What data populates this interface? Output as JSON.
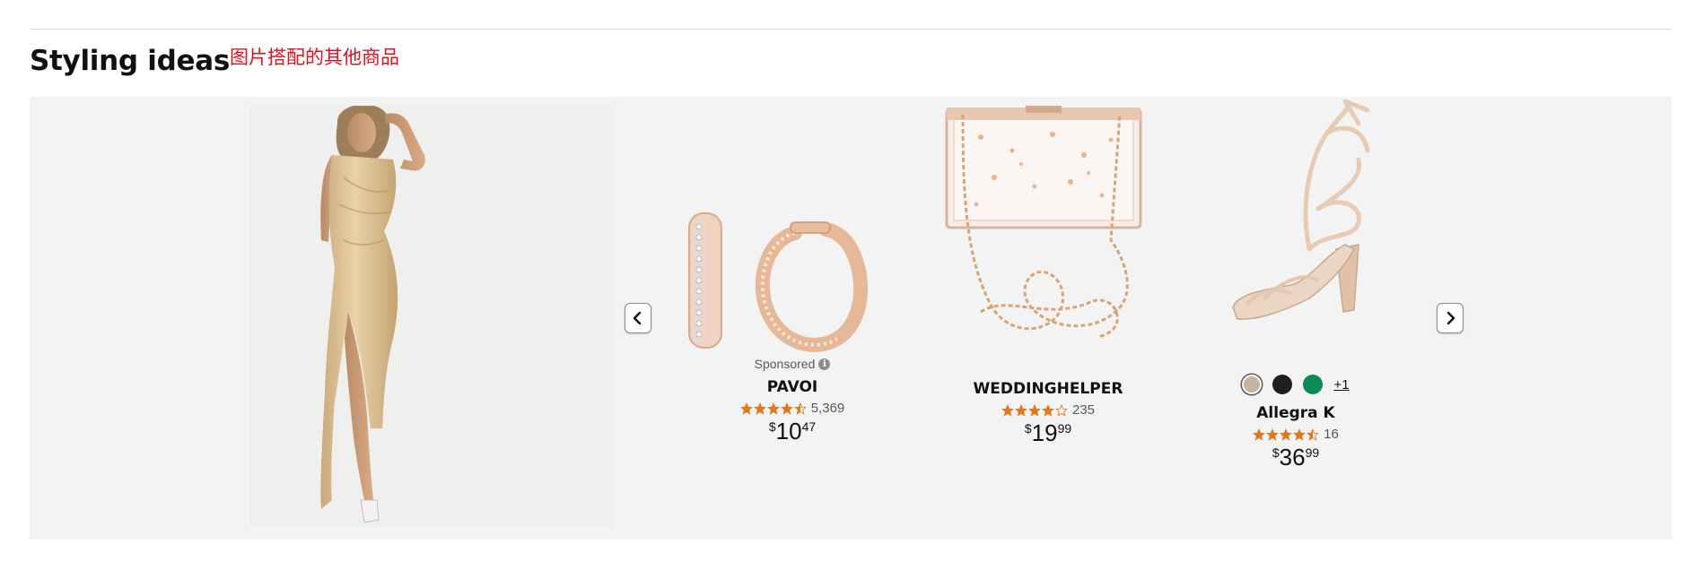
{
  "section": {
    "title": "Styling ideas",
    "annotation": "图片搭配的其他商品"
  },
  "hero": {
    "icon": "dress-photo"
  },
  "carousel": {
    "prev_icon": "chevron-left-icon",
    "next_icon": "chevron-right-icon",
    "products": [
      {
        "sponsored": "Sponsored",
        "brand": "PAVOI",
        "rating": 4.5,
        "rating_count": "5,369",
        "price_currency": "$",
        "price_whole": "10",
        "price_fraction": "47",
        "image_icon": "hoop-earrings-photo"
      },
      {
        "brand": "WEDDINGHELPER",
        "rating": 4.0,
        "rating_count": "235",
        "price_currency": "$",
        "price_whole": "19",
        "price_fraction": "99",
        "image_icon": "clutch-bag-photo"
      },
      {
        "brand": "Allegra K",
        "rating": 4.5,
        "rating_count": "16",
        "price_currency": "$",
        "price_whole": "36",
        "price_fraction": "99",
        "image_icon": "heeled-sandal-photo",
        "swatches": [
          "#c9b39f",
          "#1f1f1f",
          "#0a8a55"
        ],
        "more_colors": "+1"
      }
    ]
  },
  "colors": {
    "star": "#de7921",
    "annotation": "#e0101f",
    "panel": "#f3f3f3"
  }
}
